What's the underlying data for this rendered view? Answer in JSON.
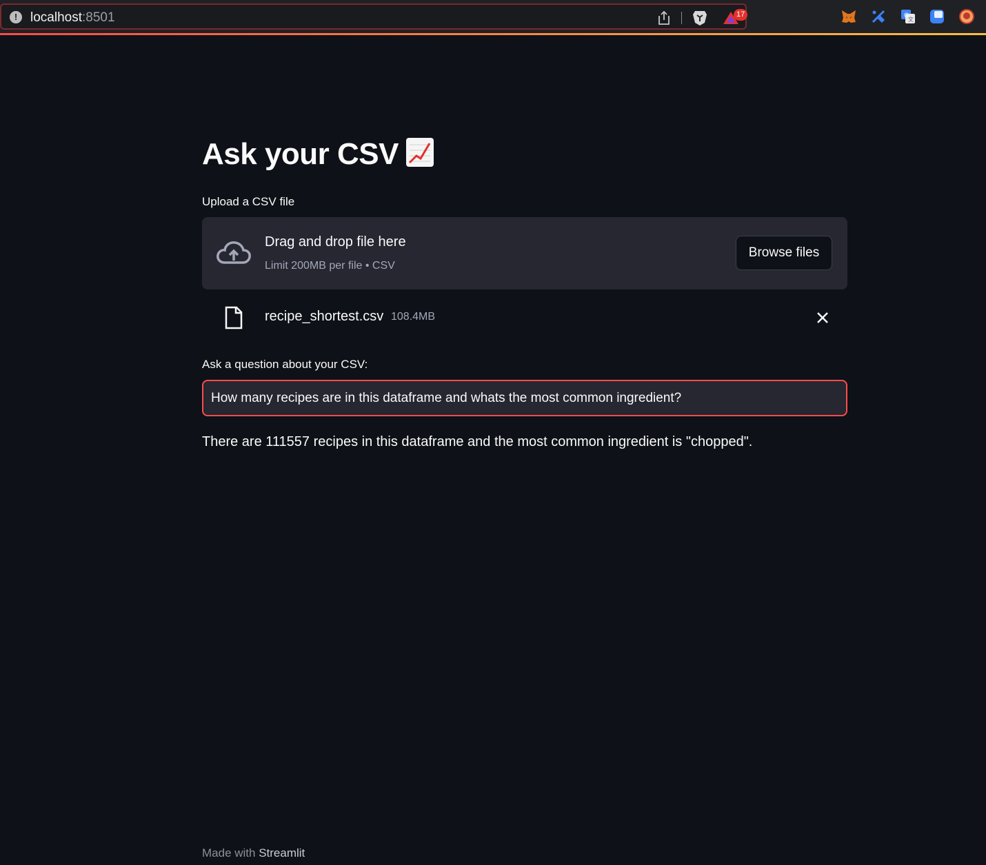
{
  "browser": {
    "url_host": "localhost",
    "url_port": ":8501",
    "notification_count": "17",
    "extension_icons": [
      "metamask-icon",
      "puzzle-icon",
      "translate-icon",
      "blue-square-icon",
      "profile-icon"
    ]
  },
  "colors": {
    "background": "#0e1117",
    "panel": "#262730",
    "accent": "#ff4b4b",
    "muted_text": "#a3a8b8"
  },
  "app": {
    "title": "Ask your CSV",
    "title_emoji": "chart-increasing-icon",
    "upload_label": "Upload a CSV file",
    "dropzone": {
      "title": "Drag and drop file here",
      "subtitle": "Limit 200MB per file • CSV",
      "browse_label": "Browse files"
    },
    "uploaded_file": {
      "name": "recipe_shortest.csv",
      "size": "108.4MB"
    },
    "question_label": "Ask a question about your CSV:",
    "question_value": "How many recipes are in this dataframe and whats the most common ingredient?",
    "answer": "There are 111557 recipes in this dataframe and the most common ingredient is \"chopped\"."
  },
  "footer": {
    "prefix": "Made with ",
    "brand": "Streamlit"
  }
}
